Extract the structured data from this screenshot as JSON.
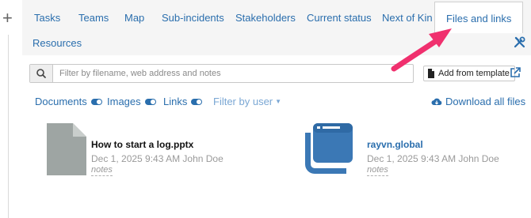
{
  "tabs": [
    {
      "label": "Tasks"
    },
    {
      "label": "Teams"
    },
    {
      "label": "Map"
    },
    {
      "label": "Sub-incidents"
    },
    {
      "label": "Stakeholders"
    },
    {
      "label": "Current status"
    },
    {
      "label": "Next of Kin"
    },
    {
      "label": "Files and links",
      "active": true
    }
  ],
  "subnav": {
    "resources_label": "Resources"
  },
  "rail": {
    "plus_label": "+"
  },
  "search": {
    "placeholder": "Filter by filename, web address and notes",
    "value": ""
  },
  "toolbar": {
    "add_from_template_label": "Add from template"
  },
  "filters": {
    "documents_label": "Documents",
    "documents_on": true,
    "images_label": "Images",
    "images_on": true,
    "links_label": "Links",
    "links_on": true,
    "filter_by_user_label": "Filter by user",
    "download_all_label": "Download all files"
  },
  "files": [
    {
      "name": "How to start a log.pptx",
      "meta": "Dec 1, 2025 9:43 AM John Doe",
      "notes": "notes",
      "icon": "document-icon"
    },
    {
      "name": "rayvn.global",
      "meta": "Dec 1, 2025 9:43 AM John Doe",
      "notes": "notes",
      "icon": "web-link-icon"
    }
  ],
  "colors": {
    "accent": "#2a6ead",
    "annotation_arrow": "#f0306e",
    "file_icon_gray": "#9ea5a3",
    "link_icon_blue": "#3b78b5"
  }
}
